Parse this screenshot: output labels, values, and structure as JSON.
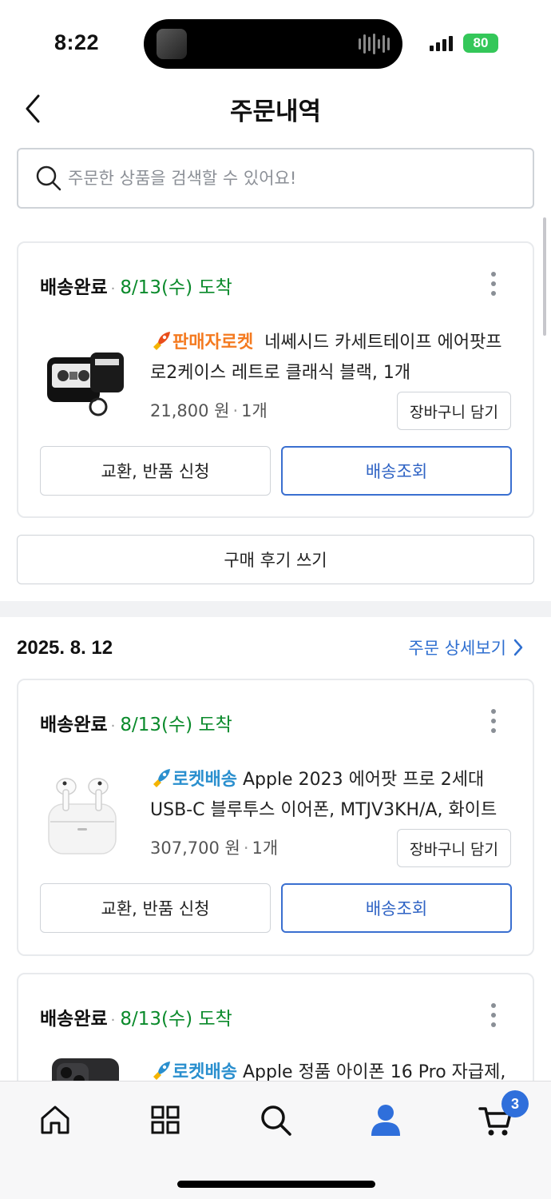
{
  "status_bar": {
    "time": "8:22",
    "battery": "80"
  },
  "header": {
    "title": "주문내역",
    "back_icon": "chevron-left-icon"
  },
  "search": {
    "placeholder": "주문한 상품을 검색할 수 있어요!"
  },
  "orders": [
    {
      "status": "배송완료",
      "arrival": "8/13(수) 도착",
      "badge": "판매자로켓",
      "product": "네쎄시드 카세트테이프 에어팟프로2케이스 레트로 클래식 블랙, 1개",
      "price": "21,800 원",
      "qty": "1개",
      "cart_label": "장바구니 담기",
      "exchange_label": "교환, 반품 신청",
      "track_label": "배송조회",
      "review_label": "구매 후기 쓰기"
    },
    {
      "order_date": "2025. 8. 12",
      "detail_link": "주문 상세보기",
      "status": "배송완료",
      "arrival": "8/13(수) 도착",
      "badge": "로켓배송",
      "product": "Apple 2023 에어팟 프로 2세대 USB-C 블루투스 이어폰, MTJV3KH/A, 화이트",
      "price": "307,700 원",
      "qty": "1개",
      "cart_label": "장바구니 담기",
      "exchange_label": "교환, 반품 신청",
      "track_label": "배송조회"
    },
    {
      "status": "배송완료",
      "arrival": "8/13(수) 도착",
      "badge": "로켓배송",
      "product": "Apple 정품 아이폰 16 Pro 자급제,"
    }
  ],
  "bottom_nav": {
    "items": [
      "home-icon",
      "grid-icon",
      "search-icon",
      "user-icon",
      "cart-icon"
    ],
    "cart_count": "3",
    "active_color": "#2f6fdb"
  }
}
